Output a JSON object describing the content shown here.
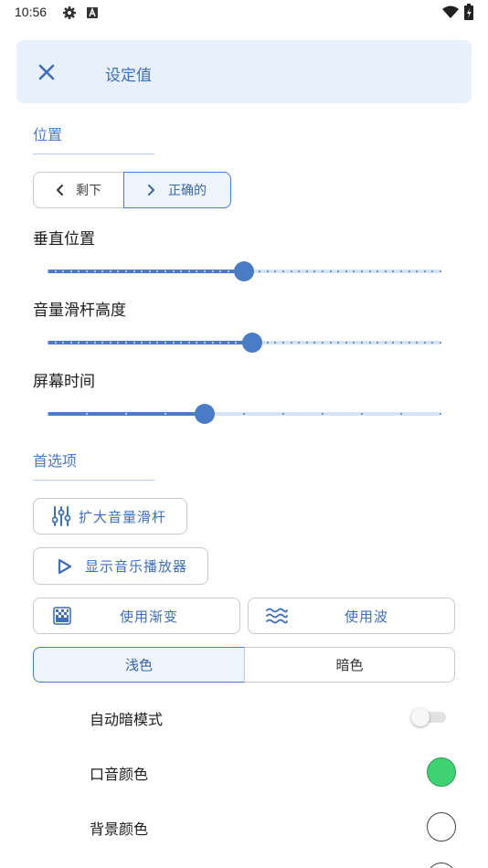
{
  "status_bar": {
    "time": "10:56"
  },
  "header": {
    "title": "设定值"
  },
  "position_section": {
    "title": "位置",
    "left_label": "剩下",
    "right_label": "正确的",
    "selected": "right"
  },
  "sliders": [
    {
      "label": "垂直位置",
      "value": 0.5
    },
    {
      "label": "音量滑杆高度",
      "value": 0.52
    },
    {
      "label": "屏幕时间",
      "value": 0.4
    }
  ],
  "preferences_section": {
    "title": "首选项",
    "expand_button": "扩大音量滑杆",
    "music_player_button": "显示音乐播放器",
    "gradient_button": "使用渐变",
    "wave_button": "使用波",
    "theme_light": "浅色",
    "theme_dark": "暗色",
    "theme_selected": "light"
  },
  "settings": {
    "auto_dark_label": "自动暗模式",
    "auto_dark_on": false,
    "accent_label": "口音颜色",
    "accent_color": "#3fd172",
    "background_label": "背景颜色",
    "background_color": "#ffffff"
  },
  "colors": {
    "accent": "#4a7cc5",
    "header_bg": "#e8f0fb"
  }
}
